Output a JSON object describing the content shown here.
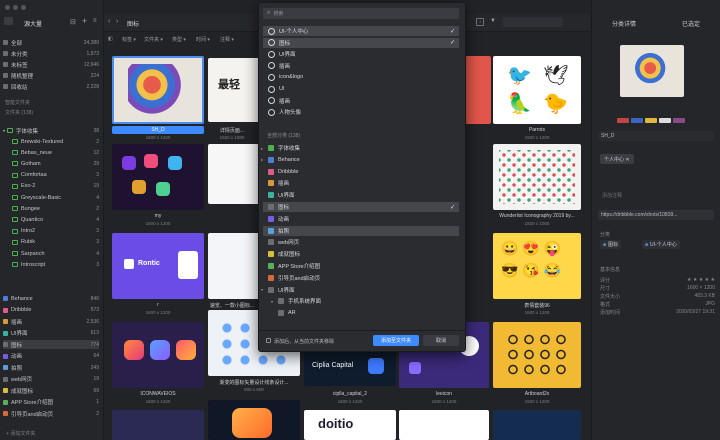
{
  "window": {
    "library": "源大量"
  },
  "sidebar": {
    "items": [
      {
        "label": "全部",
        "count": "24,380"
      },
      {
        "label": "未分类",
        "count": "1,973"
      },
      {
        "label": "未标签",
        "count": "12,946"
      },
      {
        "label": "随机整理",
        "count": "224"
      },
      {
        "label": "回收站",
        "count": "2,228"
      }
    ],
    "section_smart": "智能文件夹",
    "section_folders": "文件夹 (138)",
    "folders": [
      {
        "label": "字体收集",
        "count": "38"
      },
      {
        "label": "Brewski-Textured",
        "count": "2"
      },
      {
        "label": "Bebas_neue",
        "count": "12"
      },
      {
        "label": "Gotham",
        "count": "29"
      },
      {
        "label": "Comfortaa",
        "count": "3"
      },
      {
        "label": "Exo-2",
        "count": "19"
      },
      {
        "label": "Greyscale-Basic",
        "count": "4"
      },
      {
        "label": "Bungee",
        "count": "2"
      },
      {
        "label": "Quantico",
        "count": "4"
      },
      {
        "label": "Intro2",
        "count": "3"
      },
      {
        "label": "Rubik",
        "count": "3"
      },
      {
        "label": "Sarpanch",
        "count": "4"
      },
      {
        "label": "Introscript",
        "count": "3"
      }
    ],
    "groups": [
      {
        "label": "Behance",
        "count": "846"
      },
      {
        "label": "Dribbble",
        "count": "573"
      },
      {
        "label": "插画",
        "count": "2,536"
      },
      {
        "label": "UI界面",
        "count": "613"
      },
      {
        "label": "图标",
        "count": "774"
      },
      {
        "label": "动画",
        "count": "64"
      },
      {
        "label": "拍照",
        "count": "249"
      },
      {
        "label": "web网页",
        "count": "19"
      },
      {
        "label": "成就图标",
        "count": "69"
      },
      {
        "label": "APP Store介绍图",
        "count": "1"
      },
      {
        "label": "引导页and启动页",
        "count": "2"
      }
    ],
    "add_label": "添加文件夹"
  },
  "toolbar": {
    "title": "图标",
    "search_placeholder": "搜索"
  },
  "filters": [
    "标签",
    "文件夹",
    "类型",
    "时间",
    "注释"
  ],
  "grid": [
    {
      "name": "SH_D",
      "size": "1600 x 1200"
    },
    {
      "name": "详情页面...",
      "size": "1920 x 1080"
    },
    {
      "name": "Parrots",
      "size": "1600 x 1200"
    },
    {
      "name": "my",
      "size": "1600 x 1200"
    },
    {
      "name": "Wunderlist Iconography 2019 by...",
      "size": "1920 x 1080"
    },
    {
      "name": "r",
      "size": "1600 x 1200"
    },
    {
      "name": "速览、一款小图标...",
      "size": "800 x 600"
    },
    {
      "name": "表情套装96",
      "size": "1600 x 1200"
    },
    {
      "name": "ICONWAVEIOS",
      "size": "1600 x 1200"
    },
    {
      "name": "渐变的图标矢量设计线条设计...",
      "size": "800 x 600"
    },
    {
      "name": "ciplla_capital_2",
      "size": "1600 x 1200"
    },
    {
      "name": "leeicon",
      "size": "1600 x 1200"
    },
    {
      "name": "Artboard2x",
      "size": "1600 x 1200"
    }
  ],
  "thumb_text": {
    "ciplia": "Ciplia Capital",
    "doitio": "doitio",
    "rontic": "Rontic"
  },
  "dropdown": {
    "search_placeholder": "搜索",
    "recent": [
      {
        "label": "UI-个人中心",
        "checked": true
      },
      {
        "label": "图标",
        "checked": true
      },
      {
        "label": "UI界面"
      },
      {
        "label": "插画"
      },
      {
        "label": "icon&logo"
      },
      {
        "label": "UI"
      },
      {
        "label": "插画"
      },
      {
        "label": "人物头像"
      }
    ],
    "all_section": "全部分类 (138)",
    "all": [
      {
        "label": "字体收集",
        "arrow": true
      },
      {
        "label": "Behance",
        "arrow": true
      },
      {
        "label": "Dribbble"
      },
      {
        "label": "插画"
      },
      {
        "label": "UI界面"
      },
      {
        "label": "图标",
        "checked": true
      },
      {
        "label": "动画"
      },
      {
        "label": "拍照"
      },
      {
        "label": "web网页"
      },
      {
        "label": "成就图标"
      },
      {
        "label": "APP Store介绍图"
      },
      {
        "label": "引导页and启动页"
      },
      {
        "label": "UI界面",
        "arrow": true
      },
      {
        "label": "手机系统界面",
        "arrow": true
      },
      {
        "label": "AR"
      }
    ],
    "footer_checkbox": "添加后，从当前文件夹移除",
    "add_button": "添加至文件夹",
    "cancel_button": "取消"
  },
  "right_panel": {
    "title": "分类详情",
    "top_action": "已选定",
    "filename": "SH_D",
    "tag": "个人中心 ✕",
    "notes_placeholder": "添加注释",
    "url": "https://dribbble.com/shots/10839...",
    "folder_label": "分类",
    "folder_chips": [
      "图标",
      "UI-个人中心"
    ],
    "info_label": "基本信息",
    "props": [
      {
        "k": "评分",
        "v": "★ ★ ★ ★ ★"
      },
      {
        "k": "尺寸",
        "v": "1600 × 1200"
      },
      {
        "k": "文件大小",
        "v": "483.3 KB"
      },
      {
        "k": "格式",
        "v": "JPG"
      },
      {
        "k": "添加时间",
        "v": "2020/03/27 19:31"
      }
    ],
    "swatches": [
      "#c2453f",
      "#3a66c4",
      "#e2b53c",
      "#dcdcdc",
      "#8a4a86"
    ]
  },
  "colors": {
    "accent": "#3d8bfd",
    "folder_green": "#4caf50"
  }
}
